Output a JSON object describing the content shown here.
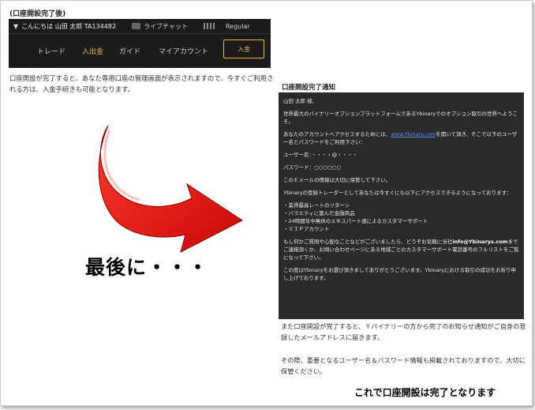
{
  "section_title": "(口座開設完了後)",
  "dashboard": {
    "greeting": "こんにちは 山田 太郎 TA134482",
    "chat_label": "ライブチャット",
    "level": "Regular",
    "nav": [
      "トレード",
      "入出金",
      "ガイド",
      "マイアカウント"
    ],
    "deposit_button": "入金"
  },
  "description": "口座開設が完了すると、あなた専用口座の管理画面が表示されますので、今すぐご利用される方は、入金手続きも可能となります。",
  "finally_text": "最後に・・・",
  "email": {
    "title": "口座開設完了通知",
    "salutation": "山田 太郎 様、",
    "welcome": "世界最大のバイナリーオプションプラットフォームであるYbinaryでのオプション取引の世界へようこそ。",
    "access_pre": "あなたのアカウントへアクセスするためには、",
    "access_link": "www.Ybinary.com",
    "access_post": "を開いて頂き、そこで以下のユーザー名とパスワードをご利用下さい：",
    "username": "ユーザー名：・・・・@・・・・",
    "password": "パスワード：○○○○○○",
    "keep_safe": "このＥメールの情報は大切に保管して下さい。",
    "registered": "Ybinaryの登録トレーダーとしてあなたは今すぐにも以下にアクセスできるようになっております：",
    "features": [
      "・業界最高レートのリターン",
      "・バラエティに富んだ金融商品",
      "・24時間年中無休のエキスパート達によるカスタマーサポート",
      "・ＶＩＰアカウント"
    ],
    "contact_pre": "もし何かご質問や心配なことなどがございましたら、どうぞお気軽に当社",
    "contact_email": "info@Ybinarys.com",
    "contact_post": "までご連絡頂くか、お問い合わせページにある地域ごとのカスタマーサポート電話番号のフルリストをご覧になって下さい。",
    "closing": "この度はYbinaryをお選び頂きましてありがとうございます。Ybinaryにおける取引の成功をお祈り申し上げております。"
  },
  "after_text": "また口座開設が完了すると、Ｙバイナリーの方から完了のお知らせ通知がご自身の登録したメールアドレスに届きます。",
  "after_text2": "その際、重要となるユーザー名＆パスワード情報も掲載されておりますので、大切に保管ください。",
  "complete_text": "これで口座開設は完了となります",
  "colors": {
    "arrow": "#e21010",
    "gold": "#e8b83c",
    "dark_panel": "#1b1b1b"
  }
}
